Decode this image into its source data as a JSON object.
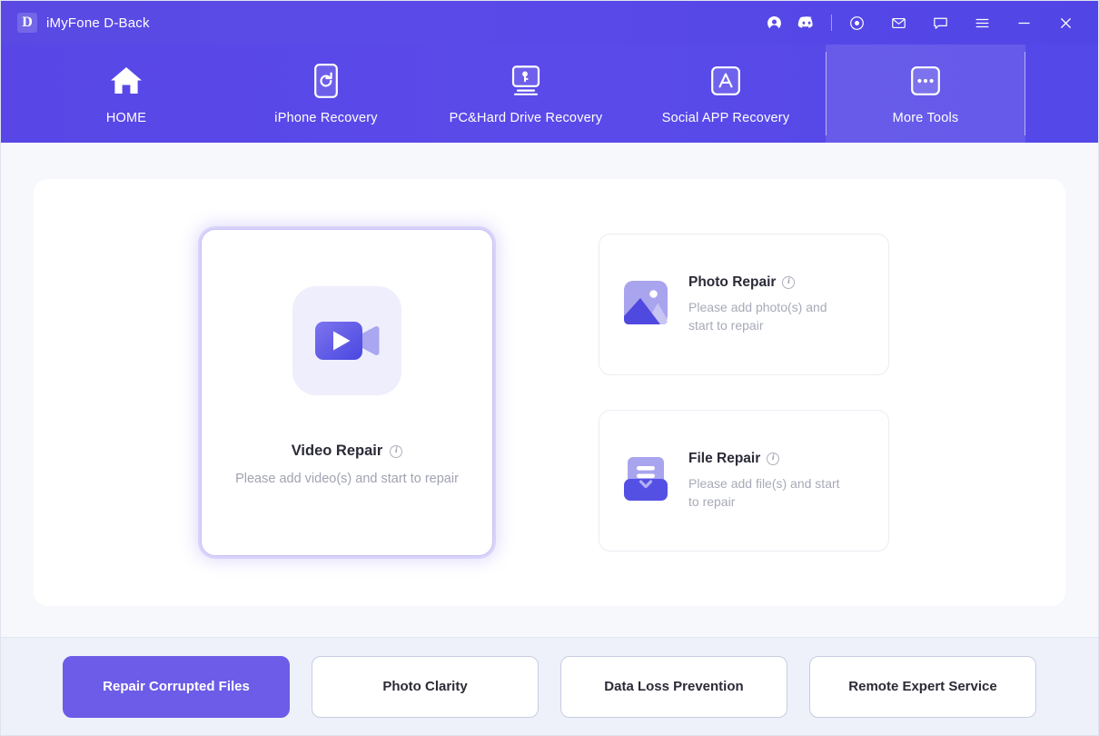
{
  "titlebar": {
    "logo_letter": "D",
    "app_name": "iMyFone D-Back",
    "icons": [
      {
        "name": "account-icon",
        "label": "Account"
      },
      {
        "name": "discord-icon",
        "label": "Discord"
      },
      {
        "name": "separator",
        "label": ""
      },
      {
        "name": "target-icon",
        "label": "Settings"
      },
      {
        "name": "mail-icon",
        "label": "Mail"
      },
      {
        "name": "chat-icon",
        "label": "Feedback"
      },
      {
        "name": "menu-icon",
        "label": "Menu"
      },
      {
        "name": "minimize-icon",
        "label": "Minimize"
      },
      {
        "name": "close-icon",
        "label": "Close"
      }
    ]
  },
  "nav": {
    "items": [
      {
        "label": "HOME",
        "icon": "home-icon",
        "active": false
      },
      {
        "label": "iPhone Recovery",
        "icon": "phone-refresh-icon",
        "active": false
      },
      {
        "label": "PC&Hard Drive Recovery",
        "icon": "monitor-key-icon",
        "active": false
      },
      {
        "label": "Social APP Recovery",
        "icon": "app-store-icon",
        "active": false
      },
      {
        "label": "More Tools",
        "icon": "ellipsis-icon",
        "active": true
      }
    ]
  },
  "main": {
    "video_card": {
      "title": "Video Repair",
      "description": "Please add video(s) and start to repair",
      "icon": "video-camera-icon",
      "info": "i",
      "selected": true
    },
    "cards": [
      {
        "title": "Photo Repair",
        "description": "Please add photo(s) and start to repair",
        "icon": "photo-image-icon",
        "info": "i"
      },
      {
        "title": "File Repair",
        "description": "Please add file(s) and start to repair",
        "icon": "file-document-icon",
        "info": "i"
      }
    ]
  },
  "bottom": {
    "buttons": [
      {
        "label": "Repair Corrupted Files",
        "primary": true
      },
      {
        "label": "Photo Clarity",
        "primary": false
      },
      {
        "label": "Data Loss Prevention",
        "primary": false
      },
      {
        "label": "Remote Expert Service",
        "primary": false
      }
    ]
  },
  "colors": {
    "accent": "#6c5ce7",
    "header": "#5a4ae8",
    "bg": "#f7f8fc",
    "bottom_bar": "#eef1fa"
  }
}
